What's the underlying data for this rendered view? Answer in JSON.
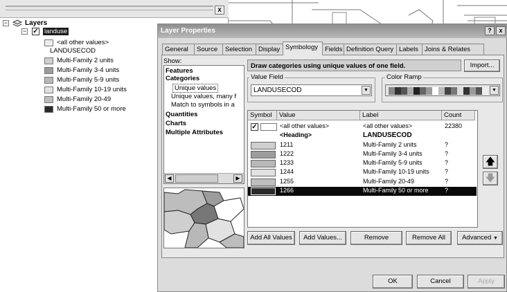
{
  "toc": {
    "close_glyph": "x",
    "layers_label": "Layers",
    "layer_name": "landuse",
    "items": [
      {
        "label": "<all other values>",
        "color": "#ececec"
      },
      {
        "label": "LANDUSECOD",
        "color": ""
      },
      {
        "label": "Multi-Family 2 units",
        "color": "#cfcfcf"
      },
      {
        "label": "Multi-Family 3-4 units",
        "color": "#9c9c9c"
      },
      {
        "label": "Multi-Family 5-9 units",
        "color": "#b8b8b8"
      },
      {
        "label": "Multi-Family 10-19 units",
        "color": "#e2e2e2"
      },
      {
        "label": "Multi-Family 20-49",
        "color": "#bdbdbd"
      },
      {
        "label": "Multi-Family 50 or more",
        "color": "#2a2a2a"
      }
    ]
  },
  "dialog": {
    "title": "Layer Properties",
    "help_glyph": "?",
    "close_glyph": "x",
    "tabs": [
      "General",
      "Source",
      "Selection",
      "Display",
      "Symbology",
      "Fields",
      "Definition Query",
      "Labels",
      "Joins & Relates"
    ],
    "active_tab": "Symbology",
    "show_label": "Show:",
    "show_items": [
      {
        "label": "Features",
        "bold": true
      },
      {
        "label": "Categories",
        "bold": true
      },
      {
        "label": "Unique values",
        "bold": false,
        "selected": true
      },
      {
        "label": "Unique values, many f",
        "bold": false
      },
      {
        "label": "Match to symbols in a",
        "bold": false
      },
      {
        "label": "Quantities",
        "bold": true
      },
      {
        "label": "Charts",
        "bold": true
      },
      {
        "label": "Multiple Attributes",
        "bold": true
      }
    ],
    "banner": "Draw categories using unique values of one field.",
    "import_button": "Import...",
    "value_field_label": "Value Field",
    "value_field_value": "LANDUSECOD",
    "color_ramp_label": "Color Ramp",
    "ramp_colors": [
      "#888",
      "#333",
      "#555",
      "#aaa",
      "#222",
      "#666",
      "#999",
      "#fff",
      "#bbb",
      "#444",
      "#777",
      "#ddd",
      "#333",
      "#999",
      "#555",
      "#eee"
    ],
    "table_headers": [
      "Symbol",
      "Value",
      "Label",
      "Count"
    ],
    "rows": [
      {
        "value": "<all other values>",
        "label": "<all other values>",
        "count": "22380",
        "color": "",
        "kind": "check"
      },
      {
        "value": "<Heading>",
        "label": "LANDUSECOD",
        "count": "",
        "color": "",
        "kind": "heading"
      },
      {
        "value": "1211",
        "label": "Multi-Family 2 units",
        "count": "?",
        "color": "#cfcfcf",
        "kind": "value"
      },
      {
        "value": "1222",
        "label": "Multi-Family 3-4 units",
        "count": "?",
        "color": "#9c9c9c",
        "kind": "value"
      },
      {
        "value": "1233",
        "label": "Multi-Family 5-9 units",
        "count": "?",
        "color": "#b8b8b8",
        "kind": "value"
      },
      {
        "value": "1244",
        "label": "Multi-Family 10-19 units",
        "count": "?",
        "color": "#e2e2e2",
        "kind": "value"
      },
      {
        "value": "1255",
        "label": "Multi-Family 20-49",
        "count": "?",
        "color": "#bdbdbd",
        "kind": "value"
      },
      {
        "value": "1266",
        "label": "Multi-Family 50 or more",
        "count": "?",
        "color": "#2a2a2a",
        "kind": "selected"
      }
    ],
    "buttons": {
      "add_all": "Add All Values",
      "add_values": "Add Values...",
      "remove": "Remove",
      "remove_all": "Remove All",
      "advanced": "Advanced",
      "ok": "OK",
      "cancel": "Cancel",
      "apply": "Apply"
    }
  }
}
